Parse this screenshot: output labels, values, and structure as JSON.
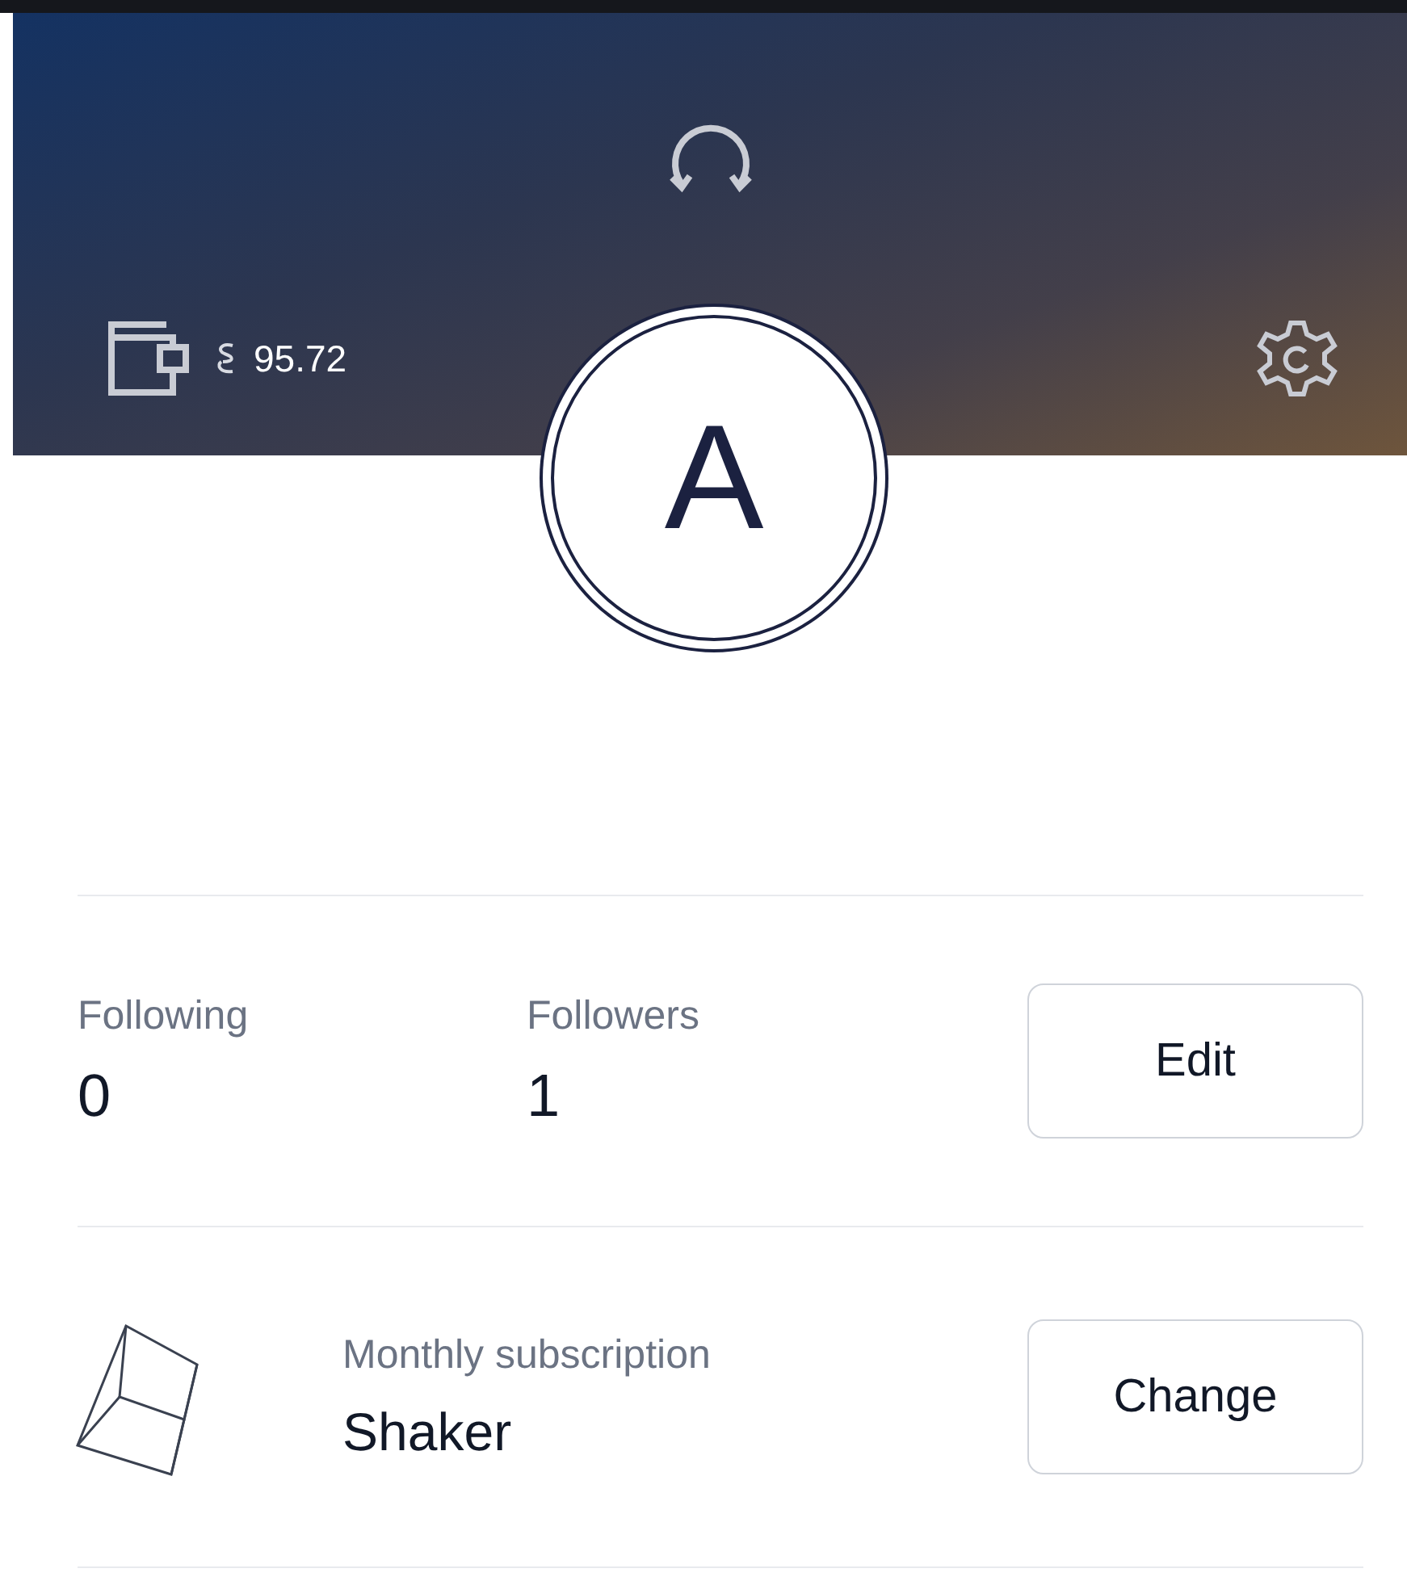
{
  "header": {
    "balance": "95.72"
  },
  "avatar": {
    "initial": "A"
  },
  "stats": [
    {
      "label": "Following",
      "value": "0"
    },
    {
      "label": "Followers",
      "value": "1"
    }
  ],
  "edit_button": "Edit",
  "subscription": {
    "label": "Monthly subscription",
    "plan": "Shaker",
    "button": "Change"
  }
}
